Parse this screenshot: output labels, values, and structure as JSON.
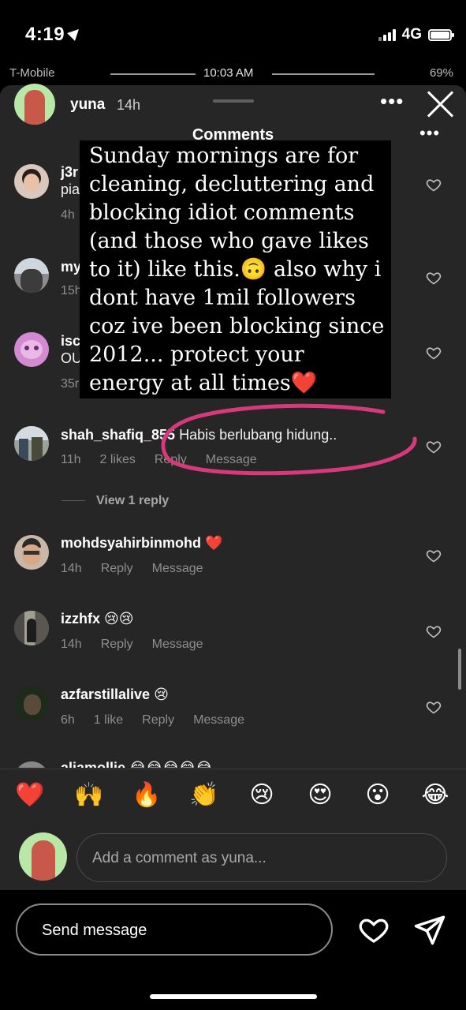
{
  "ios_status": {
    "time": "4:19",
    "network": "4G"
  },
  "story_status": {
    "carrier": "T-Mobile",
    "time": "10:03 AM",
    "battery": "69%"
  },
  "story": {
    "username": "yuna",
    "age": "14h"
  },
  "sheet": {
    "title": "Comments"
  },
  "overlay_text": "Sunday mornings are for cleaning, decluttering and blocking idiot comments (and those who gave likes to it) like this.🙃 also why i dont have 1mil followers coz ive been blocking since 2012... protect your energy at all times❤️",
  "comments": [
    {
      "user": "j3r",
      "text": "pia",
      "time": "4h"
    },
    {
      "user": "my",
      "text": "",
      "time": "15h"
    },
    {
      "user": "isc",
      "text": "OU",
      "time": "35r"
    },
    {
      "user": "shah_shafiq_855",
      "text": "Habis berlubang hidung..",
      "time": "11h",
      "likes": "2 likes",
      "reply": "Reply",
      "message": "Message"
    },
    {
      "user": "mohdsyahirbinmohd",
      "text": "❤️",
      "time": "14h",
      "reply": "Reply",
      "message": "Message"
    },
    {
      "user": "izzhfx",
      "text": "😢😢",
      "time": "14h",
      "reply": "Reply",
      "message": "Message"
    },
    {
      "user": "azfarstillalive",
      "text": "😢",
      "time": "6h",
      "likes": "1 like",
      "reply": "Reply",
      "message": "Message"
    },
    {
      "user": "aliamollie",
      "text": "😂😂😂😂😂"
    }
  ],
  "view_replies": "View 1 reply",
  "emoji_bar": [
    "❤️",
    "🙌",
    "🔥",
    "👏",
    "😢",
    "😍",
    "😮",
    "😂"
  ],
  "comment_input": {
    "placeholder": "Add a comment as yuna..."
  },
  "story_footer": {
    "send_placeholder": "Send message"
  },
  "colors": {
    "sheet_bg": "#262626",
    "annotation": "#d63a7c",
    "muted": "#8e8e8e"
  }
}
